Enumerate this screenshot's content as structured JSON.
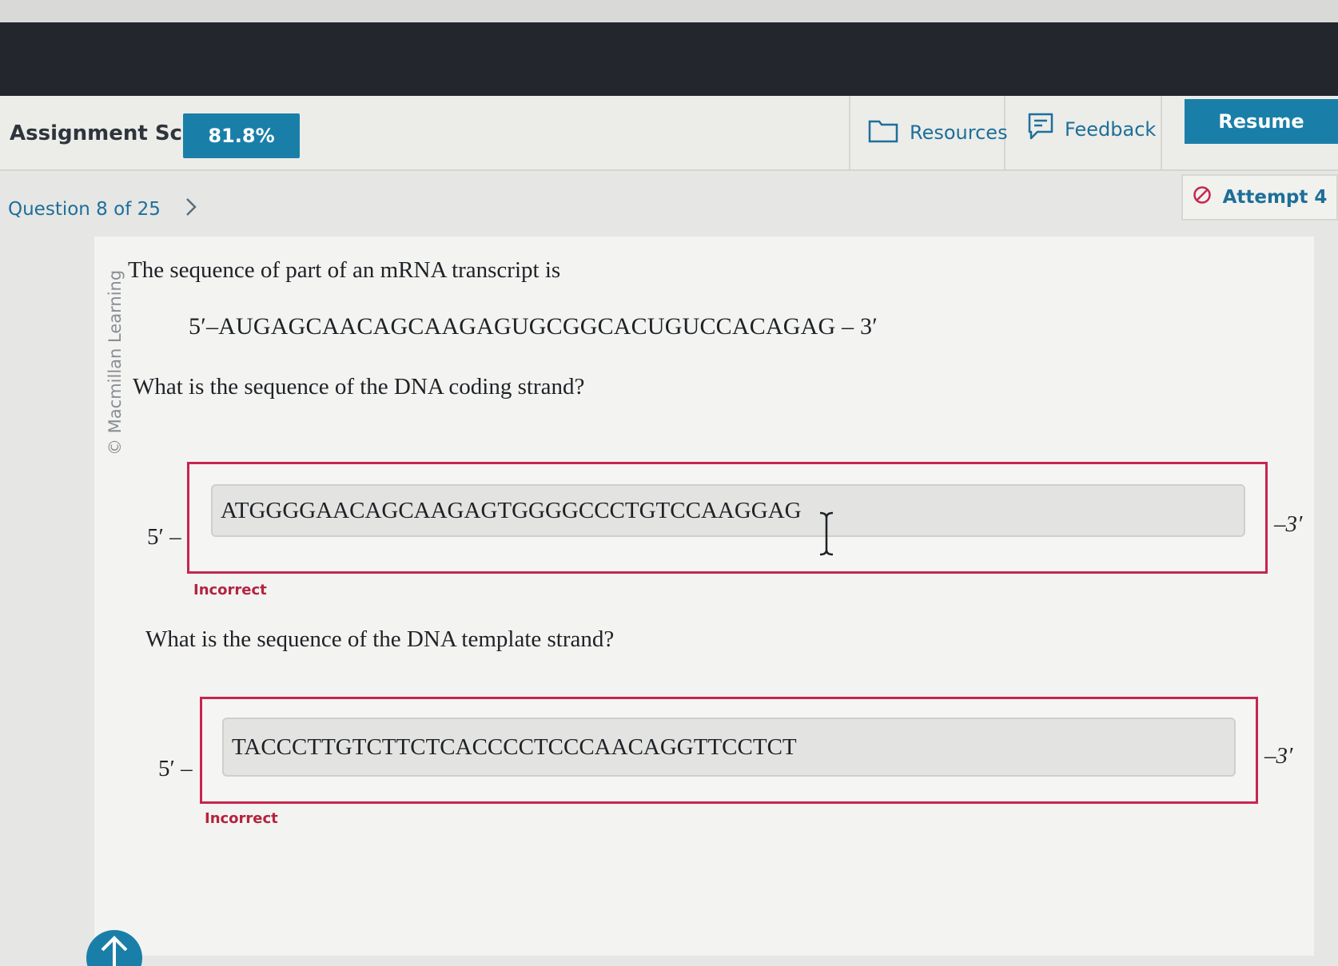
{
  "header": {
    "score_label": "Assignment Score:",
    "score_value": "81.8%",
    "resources_label": "Resources",
    "feedback_label": "Feedback",
    "resume_label": "Resume"
  },
  "nav": {
    "question_label": "Question 8 of 25",
    "attempt_label": "Attempt 4"
  },
  "copyright": "© Macmillan Learning",
  "question": {
    "intro": "The sequence of part of an mRNA transcript is",
    "mrna": "5′–AUGAGCAACAGCAAGAGUGCGGCACUGUCCACAGAG – 3′",
    "coding_prompt": "What is the sequence of the DNA coding strand?",
    "template_prompt": "What is the sequence of the DNA template strand?"
  },
  "answers": {
    "coding": {
      "prefix": "5′ –",
      "value": "ATGGGGAACAGCAAGAGTGGGGCCCTGTCCAAGGAG",
      "suffix": "–3′",
      "status": "Incorrect"
    },
    "template": {
      "prefix": "5′ –",
      "value": "TACCCTTGTCTTCTCACCCCTCCCAACAGGTTCCTCT",
      "suffix": "–3′",
      "status": "Incorrect"
    }
  },
  "colors": {
    "accent": "#1a7fa8",
    "error": "#c7254e",
    "dark_bar": "#23272d"
  }
}
